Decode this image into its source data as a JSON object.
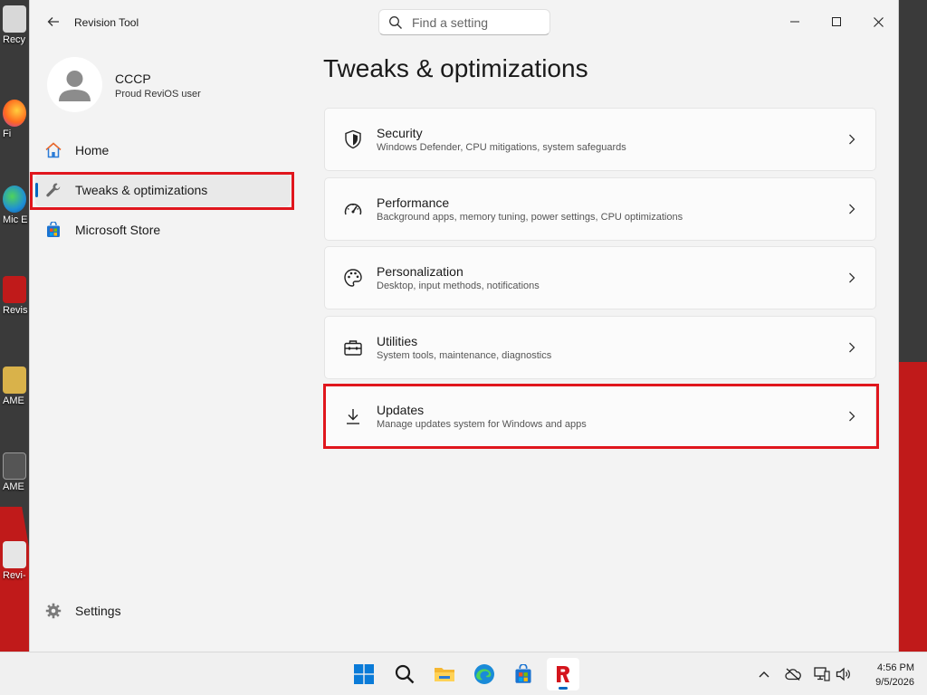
{
  "window": {
    "app_title": "Revision Tool",
    "search_placeholder": "Find a setting"
  },
  "profile": {
    "name": "CCCP",
    "subtitle": "Proud ReviOS user"
  },
  "sidebar": {
    "items": [
      {
        "label": "Home",
        "icon": "home-icon"
      },
      {
        "label": "Tweaks & optimizations",
        "icon": "wrench-icon",
        "selected": true
      },
      {
        "label": "Microsoft Store",
        "icon": "store-icon"
      }
    ],
    "settings_label": "Settings"
  },
  "main": {
    "title": "Tweaks & optimizations",
    "cards": [
      {
        "title": "Security",
        "desc": "Windows Defender, CPU mitigations, system safeguards",
        "icon": "shield-icon"
      },
      {
        "title": "Performance",
        "desc": "Background apps, memory tuning, power settings, CPU optimizations",
        "icon": "speedometer-icon"
      },
      {
        "title": "Personalization",
        "desc": "Desktop, input methods, notifications",
        "icon": "palette-icon"
      },
      {
        "title": "Utilities",
        "desc": "System tools, maintenance, diagnostics",
        "icon": "toolbox-icon"
      },
      {
        "title": "Updates",
        "desc": "Manage updates system for Windows and apps",
        "icon": "download-icon"
      }
    ]
  },
  "desktop": {
    "icons": [
      "Recy",
      "Fi",
      "Mic E",
      "Revis",
      "AME",
      "AME",
      "Revi-"
    ]
  },
  "taskbar": {
    "apps": [
      "start-icon",
      "search-icon",
      "file-explorer-icon",
      "edge-icon",
      "store-icon",
      "revision-tool-icon"
    ],
    "time": "4:56 PM",
    "date": "9/5/2026"
  },
  "colors": {
    "accent": "#0067c0",
    "highlight": "#e0161d"
  }
}
